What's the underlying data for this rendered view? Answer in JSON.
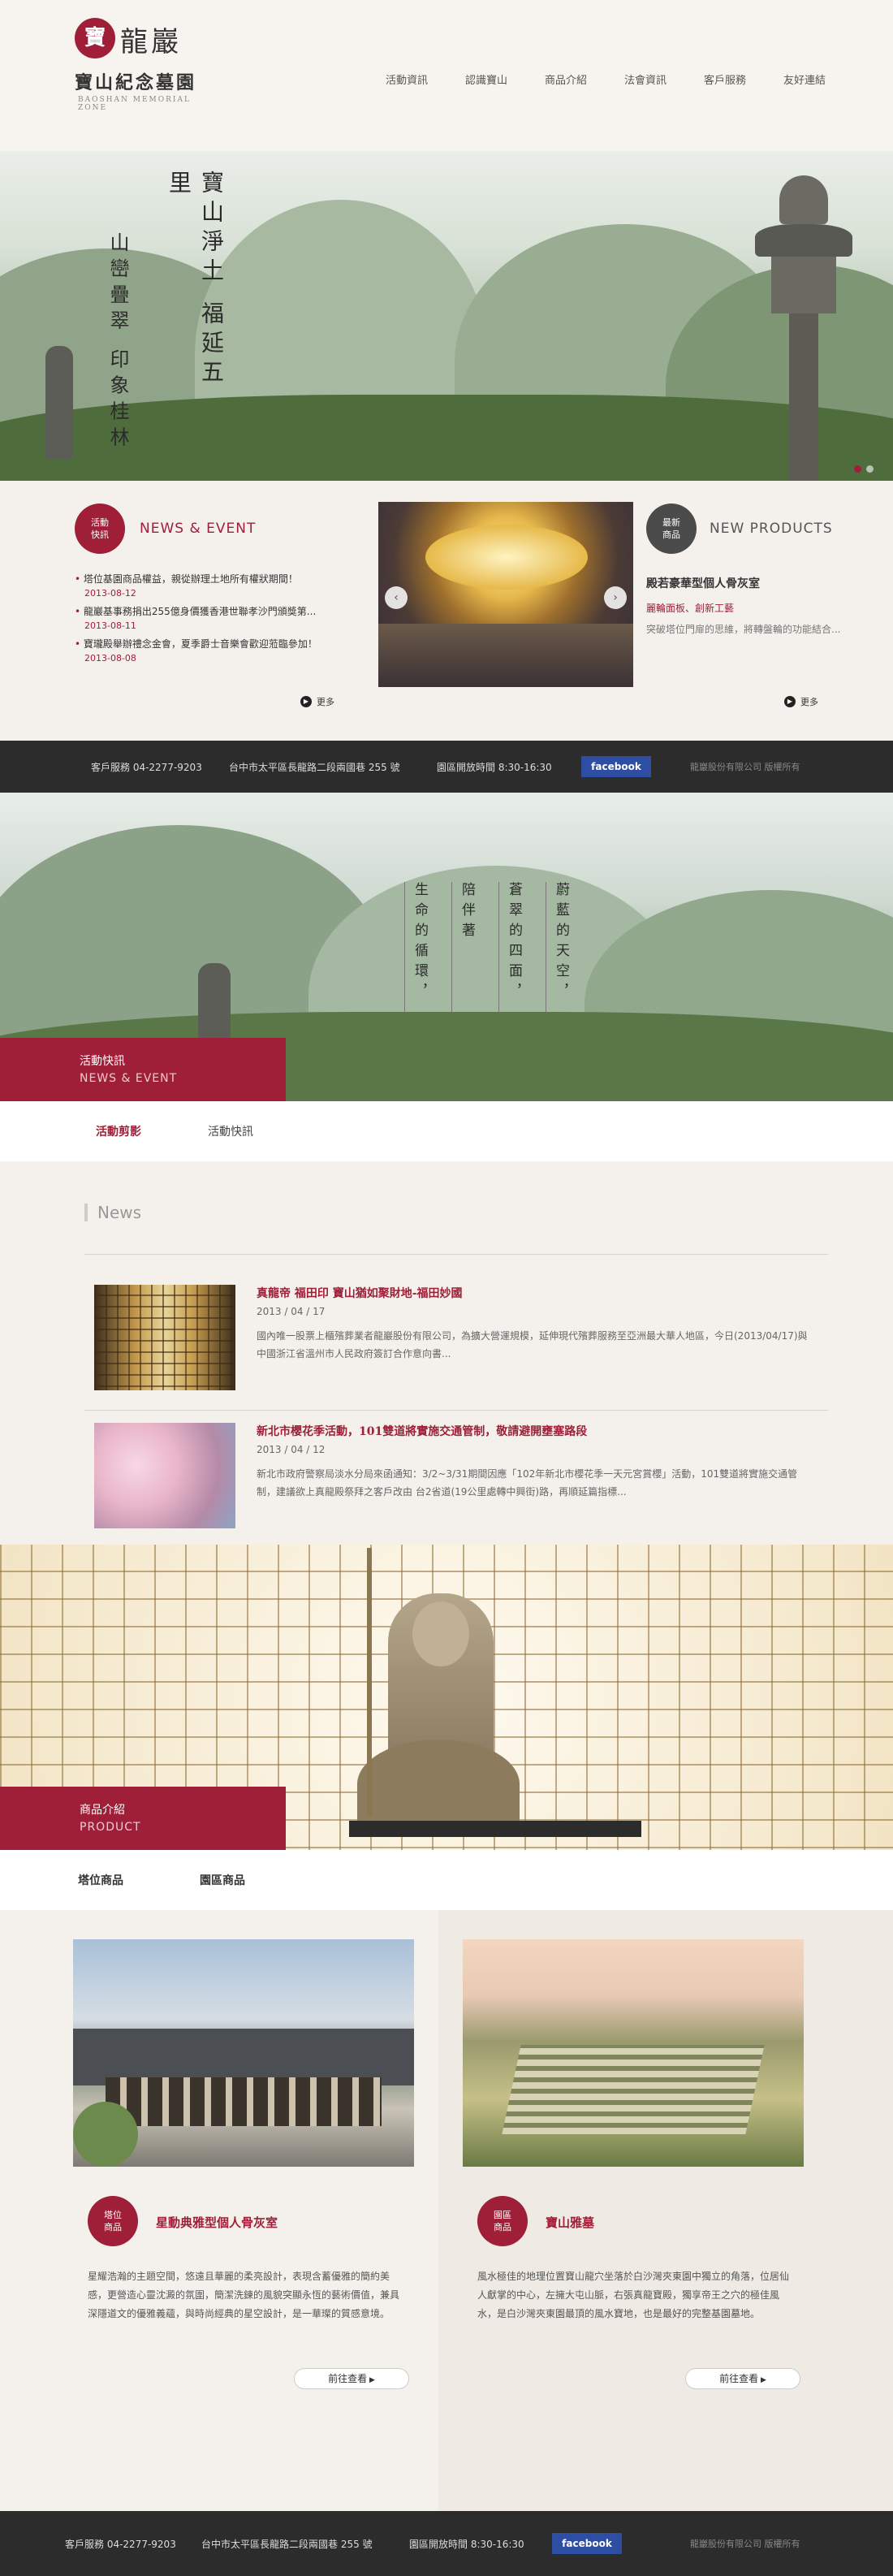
{
  "brand": {
    "mark": "寶",
    "name_cn": "龍巖",
    "site_name": "寶山紀念墓園",
    "site_name_en": "BAOSHAN MEMORIAL ZONE"
  },
  "nav": [
    "活動資訊",
    "認識寶山",
    "商品介紹",
    "法會資訊",
    "客戶服務",
    "友好連結"
  ],
  "hero": {
    "poem_line1": "寶山淨土 福延五里",
    "poem_line2": "山巒疊翠 印象桂林"
  },
  "news_block": {
    "badge": [
      "活動",
      "快訊"
    ],
    "heading_en": "NEWS & EVENT",
    "items": [
      {
        "title": "塔位基園商品權益，親從辦理土地所有權狀期間！",
        "date": "2013-08-12"
      },
      {
        "title": "龍巖基事務捐出255億身價獲香港世聯孝沙門頒獎第...",
        "date": "2013-08-11"
      },
      {
        "title": "寶瓏殿舉辦禮念金會，夏季爵士音樂會歡迎蒞臨參加！",
        "date": "2013-08-08"
      }
    ],
    "more": "更多"
  },
  "product_block": {
    "badge": [
      "最新",
      "商品"
    ],
    "heading_en": "NEW PRODUCTS",
    "name": "殿若豪華型個人骨灰室",
    "subtitle": "麗輪面板、創新工藝",
    "desc": "突破塔位門扉的思維，將轉盤輪的功能結合...",
    "more": "更多"
  },
  "info_bar": {
    "service": "客戶服務  04-2277-9203",
    "address": "台中市太平區長龍路二段兩國巷 255 號",
    "hours": "園區開放時間  8:30-16:30",
    "facebook": "facebook",
    "copyright": "龍巖股份有限公司 版權所有"
  },
  "hero2": {
    "poem": [
      "蔚藍的天空，",
      "蒼翠的四面，",
      "陪伴著",
      "生命的循環，"
    ],
    "label_cn": "活動快訊",
    "label_en": "NEWS & EVENT"
  },
  "news_tabs": [
    "活動剪影",
    "活動快訊"
  ],
  "news_section": {
    "heading": "News",
    "articles": [
      {
        "title": "真龍帝 福田印 寶山猶如聚財地-福田妙國",
        "date": "2013 / 04 / 17",
        "desc": "國內唯一股票上櫃殯葬業者龍巖股份有限公司，為擴大營運規模，延伸現代殯葬服務至亞洲最大華人地區，今日(2013/04/17)與中國浙江省溫州市人民政府簽訂合作意向書..."
      },
      {
        "title": "新北市櫻花季活動，101雙道將實施交通管制，敬請避開壅塞路段",
        "date": "2013 / 04 / 12",
        "desc": "新北市政府警察局淡水分局來函通知：3/2~3/31期間因應「102年新北市櫻花季一天元宮賞櫻」活動，101雙道將實施交通管制，建議欲上真龍殿祭拜之客戶改由 台2省道(19公里處轉中興街)路，再順延篇指標..."
      }
    ]
  },
  "product_section": {
    "label_cn": "商品介紹",
    "label_en": "PRODUCT",
    "tabs": [
      "塔位商品",
      "園區商品"
    ],
    "cards": [
      {
        "badge": [
          "塔位",
          "商品"
        ],
        "title": "星動典雅型個人骨灰室",
        "desc": "星耀浩瀚的主題空間，悠遠且華麗的柔亮設計，表現含蓄優雅的簡約美感，更營造心靈沈澱的氛圍，簡潔洗鍊的風貌突顯永恆的藝術價值，兼具深隱道文的優雅義蘊，與時尚經典的星空設計，是一華璨的質感意境。",
        "button": "前往查看"
      },
      {
        "badge": [
          "園區",
          "商品"
        ],
        "title": "寶山雅墓",
        "desc": "風水極佳的地理位置寶山龍穴坐落於白沙灣夾東園中獨立的角落，位居仙人獻掌的中心，左擁大屯山脈，右張真龍寶殿，獨享帝王之穴的極佳風水，是白沙灣夾東園最頂的風水寶地，也是最好的完整基園墓地。",
        "button": "前往查看"
      }
    ]
  },
  "colors": {
    "accent": "#9e1f37",
    "dark_bar": "#2c2c2c",
    "facebook": "#2d4ea3"
  }
}
